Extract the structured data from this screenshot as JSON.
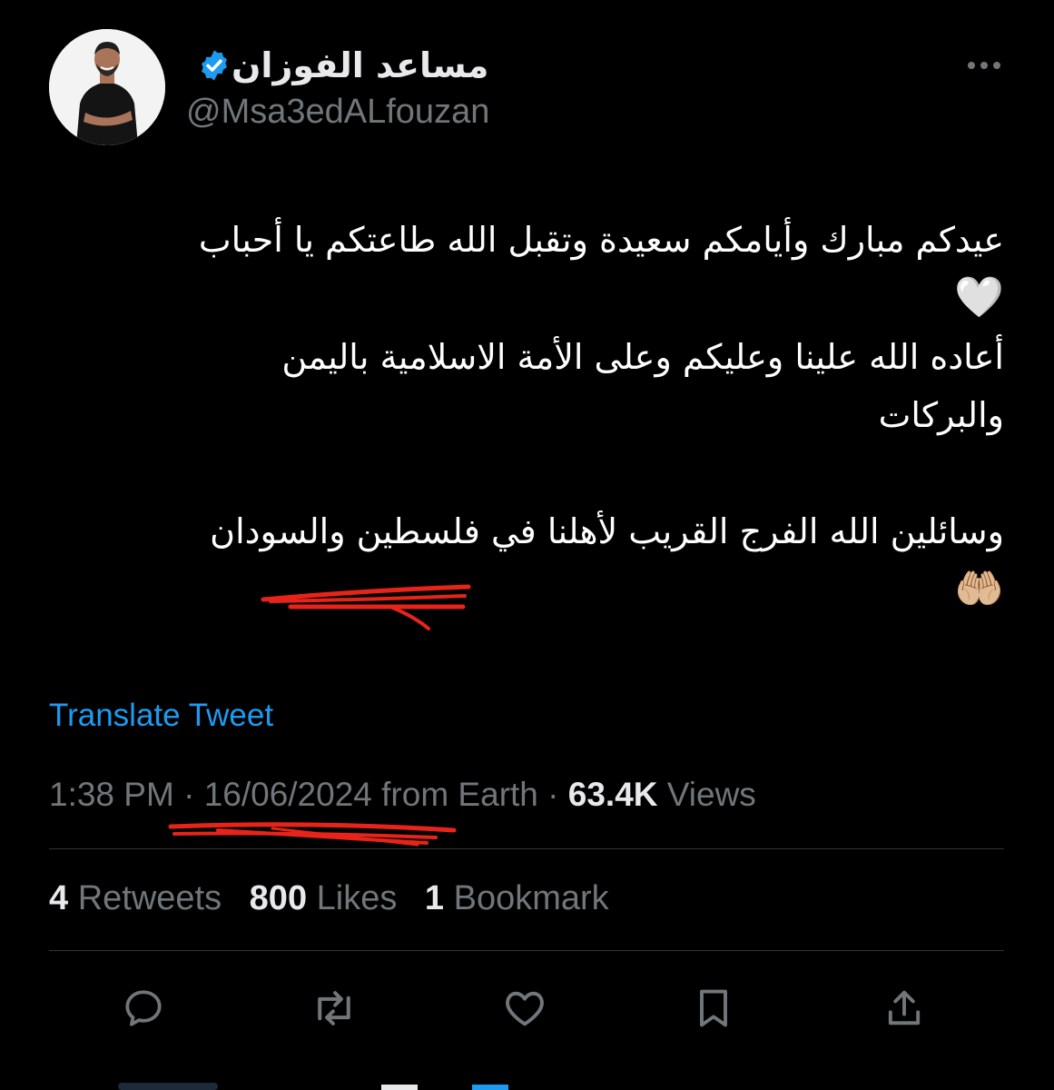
{
  "author": {
    "display_name": "مساعد الفوزان",
    "handle": "@Msa3edALfouzan",
    "verified": true
  },
  "icons": {
    "avatar": "profile-photo",
    "verified": "verified-badge-icon",
    "more": "more-options-icon"
  },
  "tweet": {
    "lines": [
      "عيدكم مبارك وأيامكم سعيدة وتقبل الله طاعتكم يا أحباب",
      "🤍",
      "أعاده الله علينا وعليكم وعلى الأمة الاسلامية باليمن",
      "والبركات",
      "",
      "وسائلين الله الفرج القريب لأهلنا في فلسطين والسودان",
      "🤲🏼"
    ]
  },
  "translate_label": "Translate Tweet",
  "meta": {
    "time": "1:38 PM",
    "sep1": " · ",
    "date": "16/06/2024",
    "source": " from Earth",
    "sep2": " · ",
    "views_count": "63.4K",
    "views_label": " Views"
  },
  "stats": {
    "retweets_count": "4",
    "retweets_label": " Retweets",
    "likes_count": "800",
    "likes_label": " Likes",
    "bookmarks_count": "1",
    "bookmarks_label": " Bookmark"
  },
  "actions": [
    "reply-icon",
    "retweet-icon",
    "like-icon",
    "bookmark-icon",
    "share-icon"
  ],
  "colors": {
    "background": "#000000",
    "text": "#e7e9ea",
    "muted": "#71767b",
    "link": "#1d9bf0",
    "verified": "#1d9bf0",
    "annotation": "#e8241a"
  }
}
